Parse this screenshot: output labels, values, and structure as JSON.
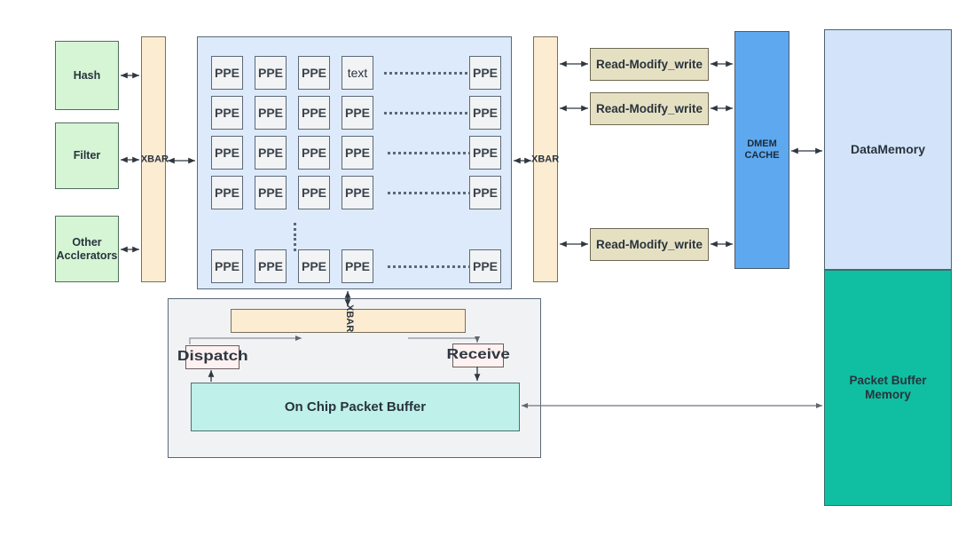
{
  "diagram": {
    "title": "Packet Processing Engine Architecture Block Diagram",
    "colors": {
      "accelerator_green": "#d5f5d5",
      "xbar_beige": "#fcecd2",
      "ppe_container_blue": "#ddeafb",
      "ppe_cell_gray": "#f2f3f4",
      "rmw_khaki": "#e6e0c3",
      "dmem_cache_blue": "#5ea8f0",
      "data_memory_blue": "#d3e4fa",
      "packet_buffer_teal": "#10bfa2",
      "panel_gray": "#f1f2f4",
      "endpoint_pink": "#fdf1f1",
      "on_chip_buffer_teal": "#bff0ea",
      "stroke": "#5b6878"
    },
    "accelerators": [
      {
        "label": "Hash"
      },
      {
        "label": "Filter"
      },
      {
        "label": "Other\nAcclerators",
        "line1": "Other",
        "line2": "Acclerators"
      }
    ],
    "left_xbar": {
      "label": "XBAR"
    },
    "right_xbar": {
      "label": "XBAR"
    },
    "bottom_xbar": {
      "label": "XBAR"
    },
    "ppe_grid": {
      "rows": [
        [
          "PPE",
          "PPE",
          "PPE",
          "text",
          "PPE"
        ],
        [
          "PPE",
          "PPE",
          "PPE",
          "PPE",
          "PPE"
        ],
        [
          "PPE",
          "PPE",
          "PPE",
          "PPE",
          "PPE"
        ],
        [
          "PPE",
          "PPE",
          "PPE",
          "PPE",
          "PPE"
        ],
        [
          "PPE",
          "PPE",
          "PPE",
          "PPE",
          "PPE"
        ]
      ],
      "row_count": 5,
      "column_count": 5,
      "horizontal_ellipsis": true,
      "vertical_ellipsis": true
    },
    "read_modify_write": [
      {
        "label": "Read-Modify_write"
      },
      {
        "label": "Read-Modify_write"
      },
      {
        "label": "Read-Modify_write"
      }
    ],
    "dmem_cache": {
      "line1": "DMEM",
      "line2": "CACHE"
    },
    "data_memory": {
      "label": "DataMemory"
    },
    "packet_buffer_memory": {
      "line1": "Packet Buffer",
      "line2": "Memory"
    },
    "dispatch": {
      "label": "Dispatch"
    },
    "receive": {
      "label": "Receive"
    },
    "on_chip_packet_buffer": {
      "label": "On Chip Packet Buffer"
    }
  }
}
